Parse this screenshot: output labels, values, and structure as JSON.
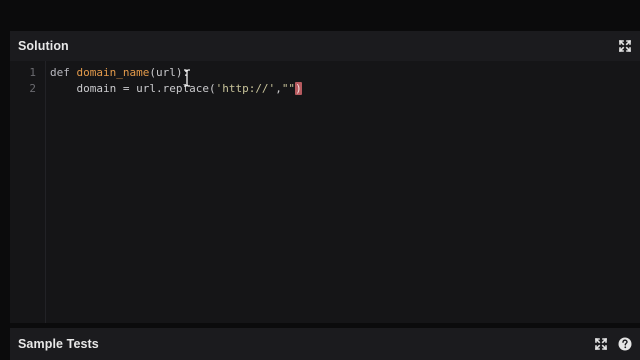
{
  "solution_panel": {
    "title": "Solution",
    "expand_icon": "expand-icon"
  },
  "editor": {
    "line_numbers": [
      "1",
      "2"
    ],
    "line1": {
      "keyword": "def ",
      "function_name": "domain_name",
      "params": "(url):"
    },
    "line2": {
      "indent": "    ",
      "code": "domain = url.replace(",
      "string1": "'http://'",
      "comma": ",",
      "string2": "\"\"",
      "closing_bracket": ")"
    },
    "cursor": "text-cursor-icon"
  },
  "tests_panel": {
    "title": "Sample Tests",
    "expand_icon": "expand-icon",
    "help_icon": "help-icon"
  },
  "colors": {
    "background": "#0b0b0c",
    "header": "#1b1b1e",
    "editor": "#151517",
    "function_name": "#e39a4b",
    "bracket_highlight": "#b65a5f"
  }
}
